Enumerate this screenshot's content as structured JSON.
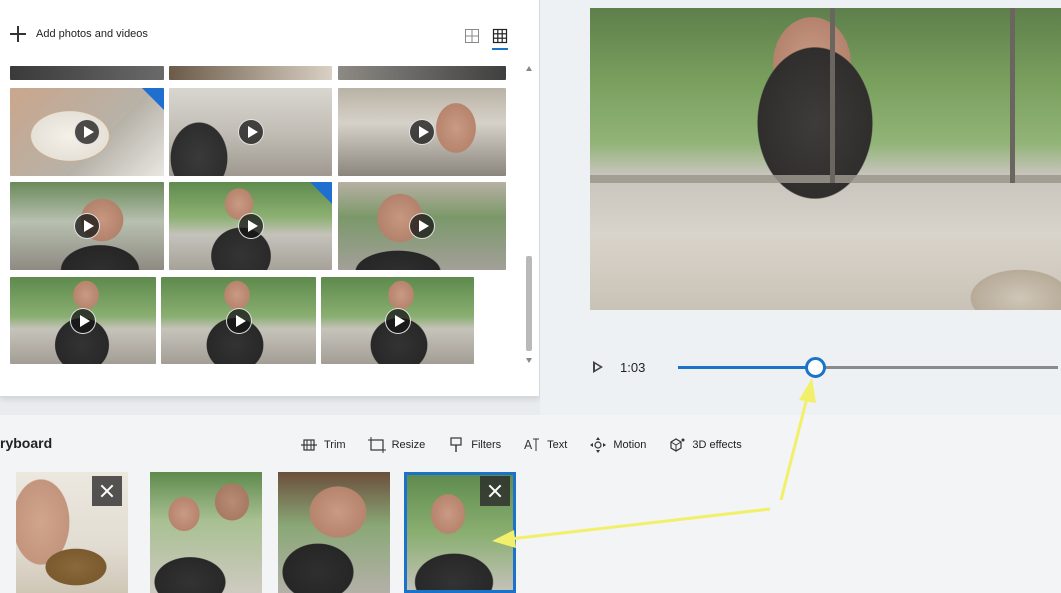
{
  "library": {
    "add_label": "Add photos and videos",
    "view_large_icon": "large-grid-icon",
    "view_small_icon": "small-grid-icon",
    "tiles": [
      {
        "name": "clip-top-1",
        "play": false,
        "corner": false
      },
      {
        "name": "clip-top-2",
        "play": false,
        "corner": false
      },
      {
        "name": "clip-top-3",
        "play": false,
        "corner": false
      },
      {
        "name": "clip-plate-wires",
        "play": true,
        "corner": true
      },
      {
        "name": "clip-boy-laptop",
        "play": true,
        "corner": false
      },
      {
        "name": "clip-boy-cafeteria",
        "play": true,
        "corner": false
      },
      {
        "name": "clip-boy-talking-1",
        "play": true,
        "corner": false
      },
      {
        "name": "clip-boy-gesture",
        "play": true,
        "corner": true
      },
      {
        "name": "clip-boy-closeup",
        "play": true,
        "corner": false
      },
      {
        "name": "clip-boy-sitting-1",
        "play": true,
        "corner": false
      },
      {
        "name": "clip-boy-sitting-2",
        "play": true,
        "corner": false
      },
      {
        "name": "clip-boy-sitting-3",
        "play": true,
        "corner": false
      }
    ]
  },
  "preview": {
    "time": "1:03",
    "progress": 0.36
  },
  "storyboard": {
    "title": "ryboard",
    "tools": [
      {
        "label": "Trim",
        "icon": "trim-icon"
      },
      {
        "label": "Resize",
        "icon": "resize-icon"
      },
      {
        "label": "Filters",
        "icon": "filters-icon"
      },
      {
        "label": "Text",
        "icon": "text-icon"
      },
      {
        "label": "Motion",
        "icon": "motion-icon"
      },
      {
        "label": "3D effects",
        "icon": "3d-effects-icon"
      }
    ],
    "clips": [
      {
        "name": "storyboard-clip-wires",
        "selected": false,
        "removable": true
      },
      {
        "name": "storyboard-clip-boys",
        "selected": false,
        "removable": false
      },
      {
        "name": "storyboard-clip-boy-working",
        "selected": false,
        "removable": false
      },
      {
        "name": "storyboard-clip-boy-talking",
        "selected": true,
        "removable": true
      }
    ]
  },
  "colors": {
    "accent": "#1a73c9",
    "annotation_arrow": "#f2f06a"
  }
}
